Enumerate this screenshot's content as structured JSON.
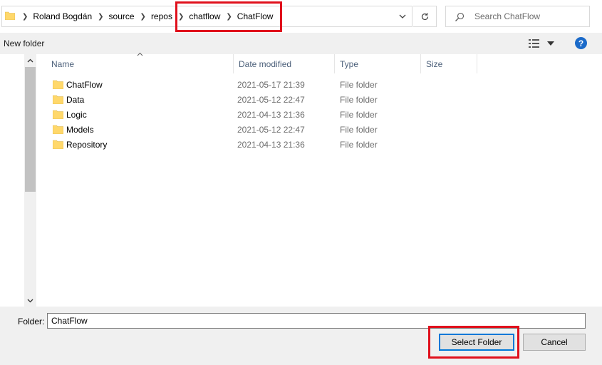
{
  "address_bar": {
    "crumbs": [
      "Roland Bogdán",
      "source",
      "repos",
      "chatflow",
      "ChatFlow"
    ]
  },
  "search": {
    "placeholder": "Search ChatFlow"
  },
  "toolbar": {
    "new_folder_label": "New folder",
    "help_label": "?"
  },
  "list": {
    "columns": [
      "Name",
      "Date modified",
      "Type",
      "Size"
    ],
    "rows": [
      {
        "name": "ChatFlow",
        "date": "2021-05-17 21:39",
        "type": "File folder"
      },
      {
        "name": "Data",
        "date": "2021-05-12 22:47",
        "type": "File folder"
      },
      {
        "name": "Logic",
        "date": "2021-04-13 21:36",
        "type": "File folder"
      },
      {
        "name": "Models",
        "date": "2021-05-12 22:47",
        "type": "File folder"
      },
      {
        "name": "Repository",
        "date": "2021-04-13 21:36",
        "type": "File folder"
      }
    ]
  },
  "bottom": {
    "folder_label": "Folder:",
    "folder_value": "ChatFlow",
    "select_label": "Select Folder",
    "cancel_label": "Cancel"
  },
  "colors": {
    "highlight": "#e0101c",
    "accent": "#0078d7",
    "folder": "#ffd86b"
  }
}
